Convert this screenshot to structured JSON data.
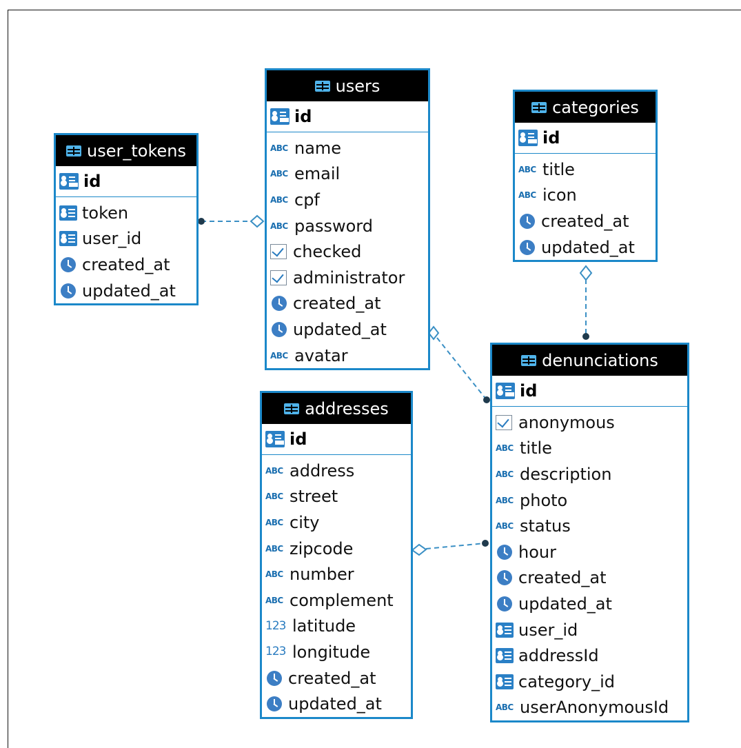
{
  "tables": {
    "user_tokens": {
      "name": "user_tokens",
      "pk": "id",
      "columns": [
        {
          "name": "token",
          "type": "fk"
        },
        {
          "name": "user_id",
          "type": "fk"
        },
        {
          "name": "created_at",
          "type": "clock"
        },
        {
          "name": "updated_at",
          "type": "clock"
        }
      ]
    },
    "users": {
      "name": "users",
      "pk": "id",
      "columns": [
        {
          "name": "name",
          "type": "abc"
        },
        {
          "name": "email",
          "type": "abc"
        },
        {
          "name": "cpf",
          "type": "abc"
        },
        {
          "name": "password",
          "type": "abc"
        },
        {
          "name": "checked",
          "type": "check"
        },
        {
          "name": "administrator",
          "type": "check"
        },
        {
          "name": "created_at",
          "type": "clock"
        },
        {
          "name": "updated_at",
          "type": "clock"
        },
        {
          "name": "avatar",
          "type": "abc"
        }
      ]
    },
    "categories": {
      "name": "categories",
      "pk": "id",
      "columns": [
        {
          "name": "title",
          "type": "abc"
        },
        {
          "name": "icon",
          "type": "abc"
        },
        {
          "name": "created_at",
          "type": "clock"
        },
        {
          "name": "updated_at",
          "type": "clock"
        }
      ]
    },
    "addresses": {
      "name": "addresses",
      "pk": "id",
      "columns": [
        {
          "name": "address",
          "type": "abc"
        },
        {
          "name": "street",
          "type": "abc"
        },
        {
          "name": "city",
          "type": "abc"
        },
        {
          "name": "zipcode",
          "type": "abc"
        },
        {
          "name": "number",
          "type": "abc"
        },
        {
          "name": "complement",
          "type": "abc"
        },
        {
          "name": "latitude",
          "type": "num"
        },
        {
          "name": "longitude",
          "type": "num"
        },
        {
          "name": "created_at",
          "type": "clock"
        },
        {
          "name": "updated_at",
          "type": "clock"
        }
      ]
    },
    "denunciations": {
      "name": "denunciations",
      "pk": "id",
      "columns": [
        {
          "name": "anonymous",
          "type": "check"
        },
        {
          "name": "title",
          "type": "abc"
        },
        {
          "name": "description",
          "type": "abc"
        },
        {
          "name": "photo",
          "type": "abc"
        },
        {
          "name": "status",
          "type": "abc"
        },
        {
          "name": "hour",
          "type": "clock"
        },
        {
          "name": "created_at",
          "type": "clock"
        },
        {
          "name": "updated_at",
          "type": "clock"
        },
        {
          "name": "user_id",
          "type": "fk"
        },
        {
          "name": "addressId",
          "type": "fk"
        },
        {
          "name": "category_id",
          "type": "fk"
        },
        {
          "name": "userAnonymousId",
          "type": "abc"
        }
      ]
    }
  },
  "icon_glyphs": {
    "abc": "ABC",
    "num": "123"
  },
  "relationships": [
    {
      "from": "user_tokens",
      "to": "users"
    },
    {
      "from": "denunciations",
      "to": "users"
    },
    {
      "from": "denunciations",
      "to": "categories"
    },
    {
      "from": "denunciations",
      "to": "addresses"
    }
  ],
  "colors": {
    "border": "#1b88c9",
    "header": "#000000",
    "link": "#3a8fc4",
    "dot": "#1f3a4d"
  }
}
